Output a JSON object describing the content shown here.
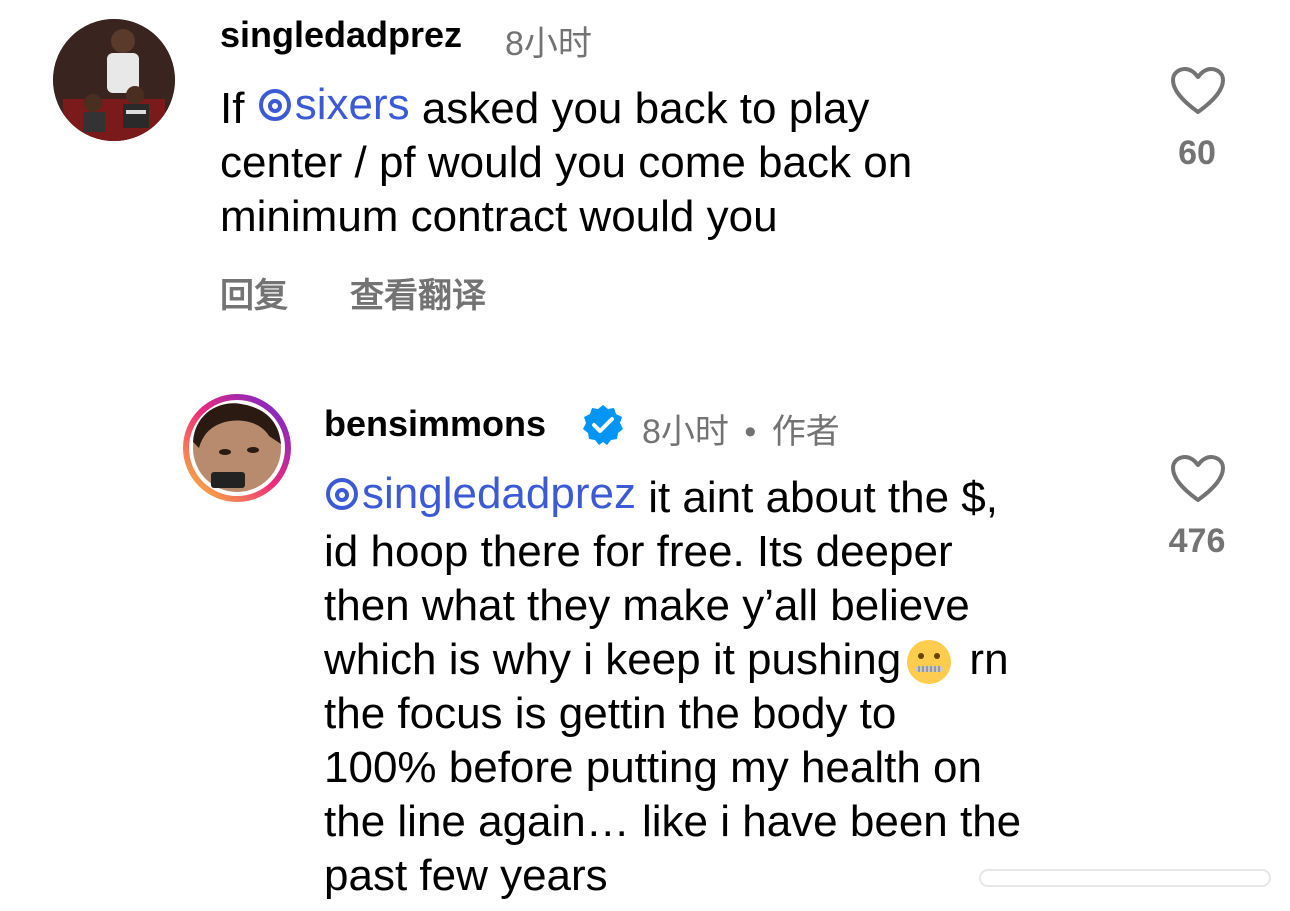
{
  "comment1": {
    "username": "singledadprez",
    "time": "8小时",
    "mention": "sixers",
    "lines": [
      "asked you back to play",
      "center / pf would you come back on",
      "minimum contract would you"
    ],
    "prefix": "If ",
    "likes": "60",
    "reply_label": "回复",
    "translate_label": "查看翻译"
  },
  "comment2": {
    "username": "bensimmons",
    "time": "8小时",
    "separator": "•",
    "author_label": "作者",
    "mention": "singledadprez",
    "lines": [
      " it aint about the $,",
      "id hoop there for free. Its deeper",
      "then what they make y’all believe",
      "which is why i keep it pushing",
      " rn",
      "the focus is gettin the body to",
      "100% before putting my health on",
      "the line again… like i have been the",
      "past few years"
    ],
    "emoji": "zipper-mouth-face-icon",
    "likes": "476",
    "verified": "verified-badge-icon"
  },
  "colors": {
    "mention": "#3d5ad6",
    "secondary": "#737373",
    "verified": "#0095f6"
  }
}
